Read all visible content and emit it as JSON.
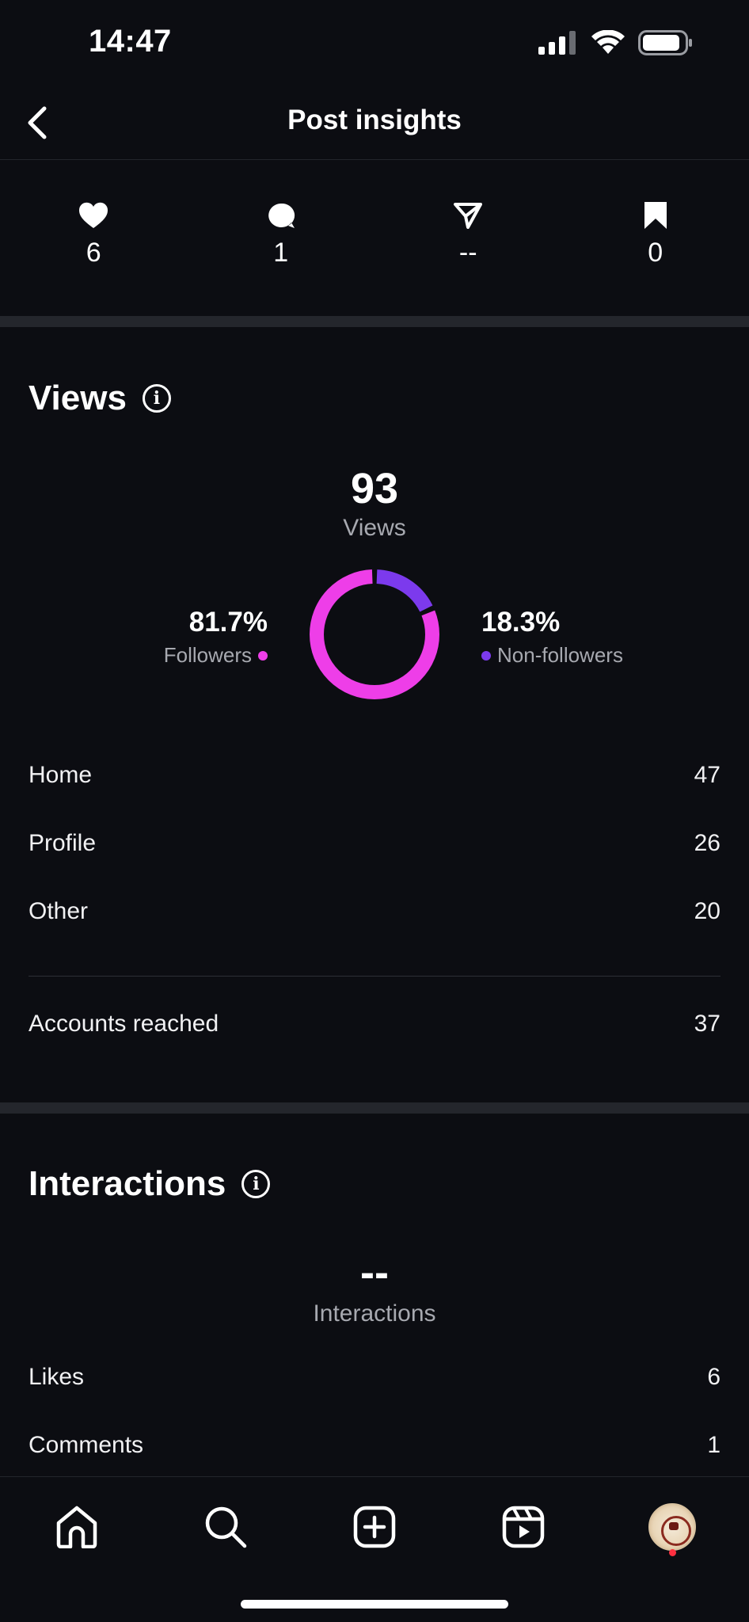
{
  "status_bar": {
    "time": "14:47"
  },
  "header": {
    "title": "Post insights"
  },
  "stats": [
    {
      "icon": "heart-icon",
      "value": "6"
    },
    {
      "icon": "comment-icon",
      "value": "1"
    },
    {
      "icon": "share-icon",
      "value": "--"
    },
    {
      "icon": "bookmark-icon",
      "value": "0"
    }
  ],
  "views": {
    "title": "Views",
    "total": "93",
    "total_label": "Views",
    "followers_pct": "81.7%",
    "followers_label": "Followers",
    "nonfollowers_pct": "18.3%",
    "nonfollowers_label": "Non-followers",
    "followers_color": "#ee3ee8",
    "nonfollowers_color": "#7c3aed",
    "followers_fraction": 0.817,
    "sources": [
      {
        "label": "Home",
        "value": "47"
      },
      {
        "label": "Profile",
        "value": "26"
      },
      {
        "label": "Other",
        "value": "20"
      }
    ],
    "accounts_reached_label": "Accounts reached",
    "accounts_reached_value": "37"
  },
  "interactions": {
    "title": "Interactions",
    "total": "--",
    "total_label": "Interactions",
    "rows": [
      {
        "label": "Likes",
        "value": "6"
      },
      {
        "label": "Comments",
        "value": "1"
      }
    ]
  },
  "bottom_nav": [
    "home-icon",
    "search-icon",
    "create-icon",
    "reels-icon",
    "profile-avatar"
  ]
}
